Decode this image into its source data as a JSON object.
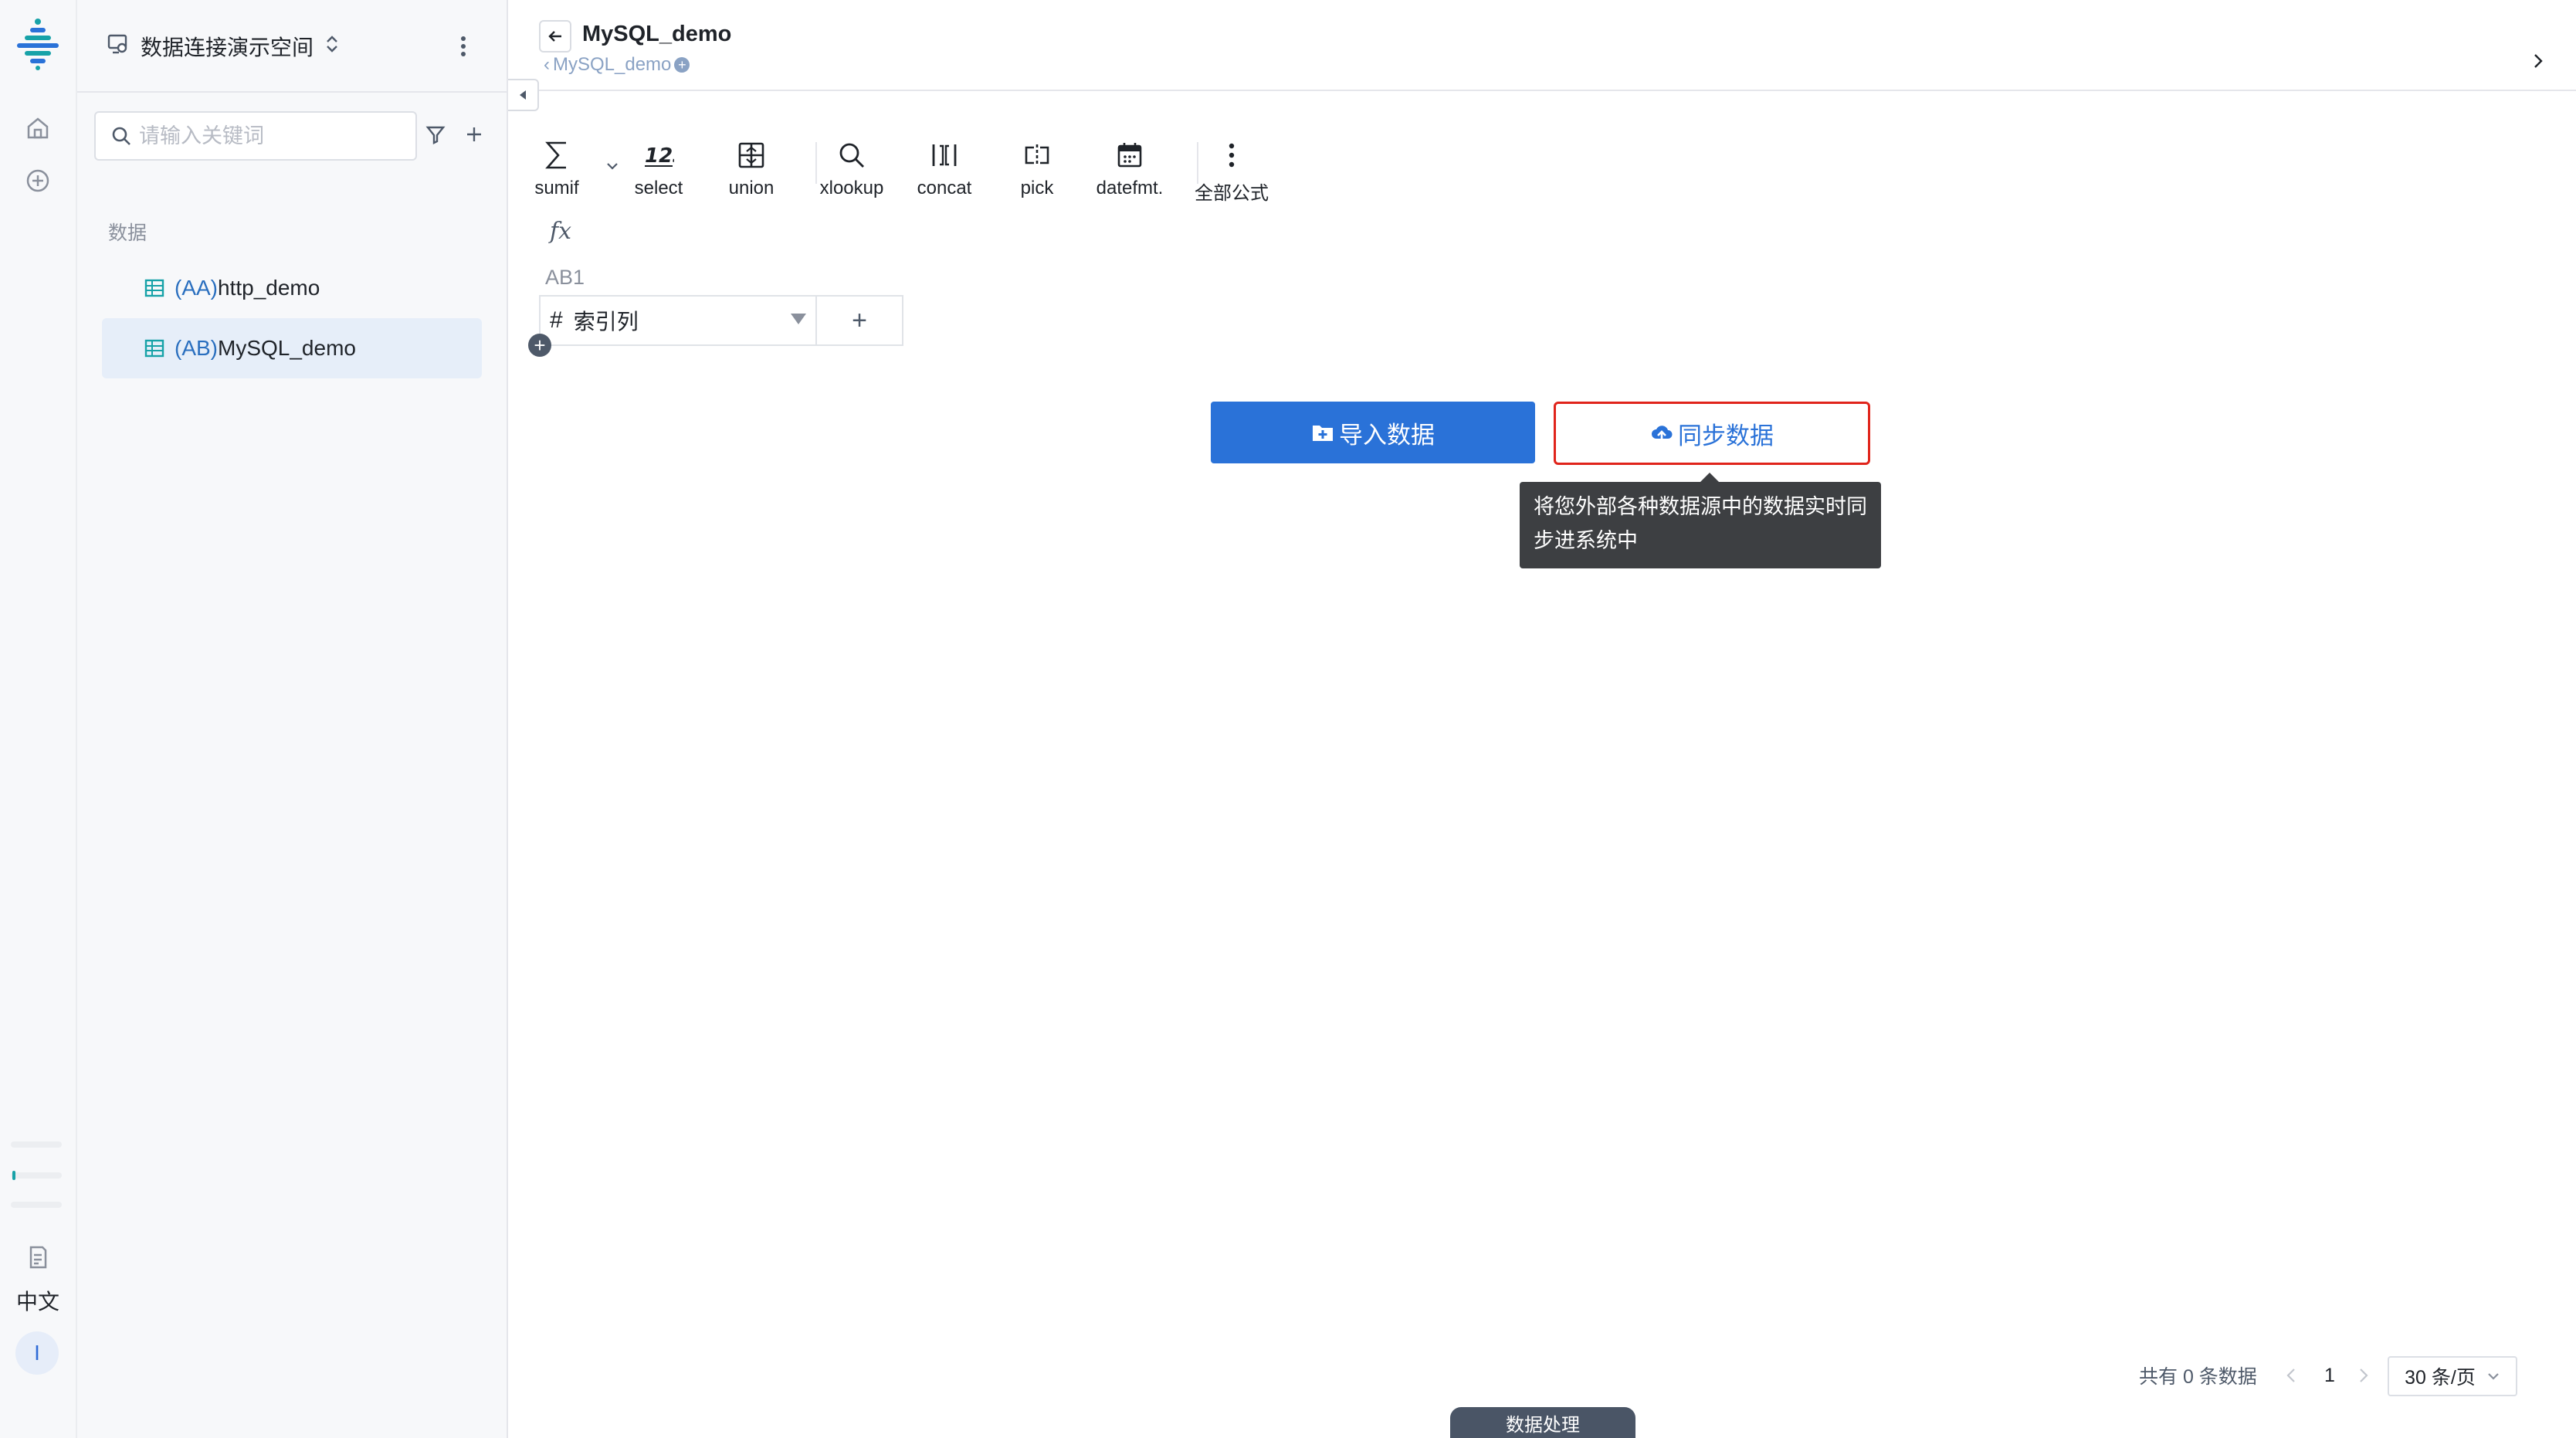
{
  "app": {
    "workspace_name": "数据连接演示空间",
    "language": "中文",
    "avatar_initial": "I"
  },
  "sidebar": {
    "search_placeholder": "请输入关键词",
    "section_label": "数据",
    "items": [
      {
        "code": "(AA)",
        "name": "http_demo",
        "active": false
      },
      {
        "code": "(AB)",
        "name": "MySQL_demo",
        "active": true
      }
    ]
  },
  "header": {
    "title": "MySQL_demo",
    "breadcrumb": "MySQL_demo"
  },
  "toolbar": {
    "tools": [
      {
        "label": "sumif",
        "icon": "sigma-icon"
      },
      {
        "label": "select",
        "icon": "number-icon"
      },
      {
        "label": "union",
        "icon": "union-icon"
      },
      {
        "label": "xlookup",
        "icon": "search-icon"
      },
      {
        "label": "concat",
        "icon": "concat-icon"
      },
      {
        "label": "pick",
        "icon": "pick-icon"
      },
      {
        "label": "datefmt.",
        "icon": "calendar-icon"
      },
      {
        "label": "全部公式",
        "icon": "more-vertical-icon"
      }
    ],
    "fx_label": "fx"
  },
  "sheet": {
    "cell_ref": "AB1",
    "column_name": "索引列",
    "column_type_symbol": "#",
    "add_column_symbol": "+"
  },
  "actions": {
    "import_label": "导入数据",
    "sync_label": "同步数据",
    "sync_tooltip_line1": "将您外部各种数据源中的数据实时同",
    "sync_tooltip_line2": "步进系统中"
  },
  "pagination": {
    "total_text": "共有 0 条数据",
    "current_page": "1",
    "page_size": "30 条/页"
  },
  "bottom_tab": {
    "label": "数据处理"
  },
  "colors": {
    "primary": "#2a72d8",
    "highlight_border": "#e0241b",
    "tooltip_bg": "#3d3f42",
    "active_item_bg": "#e6eef9",
    "brand_teal": "#17a2a8"
  }
}
